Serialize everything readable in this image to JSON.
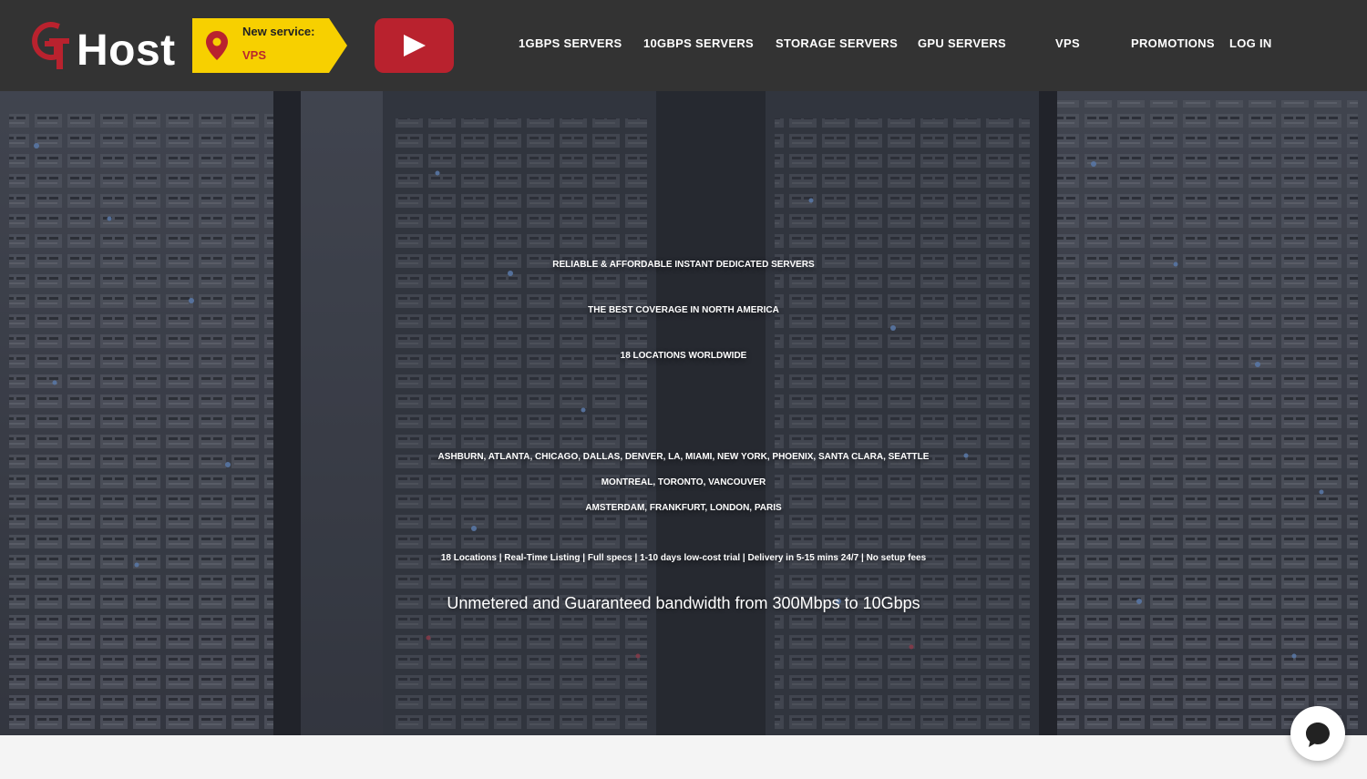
{
  "header": {
    "logo": {
      "text": "Host"
    },
    "promo": {
      "line1": "New service:",
      "line2": "VPS"
    },
    "nav": [
      {
        "label": "1GBPS SERVERS"
      },
      {
        "label": "10GBPS SERVERS"
      },
      {
        "label": "STORAGE SERVERS"
      },
      {
        "label": "GPU SERVERS"
      },
      {
        "label": "VPS"
      },
      {
        "label": "PROMOTIONS"
      },
      {
        "label": "LOG IN"
      }
    ]
  },
  "hero": {
    "headline": [
      "RELIABLE & AFFORDABLE INSTANT DEDICATED SERVERS",
      "THE BEST COVERAGE IN NORTH AMERICA",
      "18 LOCATIONS WORLDWIDE"
    ],
    "locations": [
      "ASHBURN, ATLANTA, CHICAGO, DALLAS, DENVER, LA, MIAMI, NEW YORK, PHOENIX, SANTA CLARA, SEATTLE",
      "MONTREAL, TORONTO, VANCOUVER",
      "AMSTERDAM, FRANKFURT, LONDON, PARIS"
    ],
    "features": "18 Locations | Real-Time Listing | Full specs | 1-10 days low-cost trial | Delivery in 5-15 mins 24/7 | No setup fees",
    "bandwidth": "Unmetered and Guaranteed bandwidth from 300Mbps to 10Gbps"
  },
  "colors": {
    "header_bg": "#333333",
    "brand_red": "#b9222e",
    "promo_yellow": "#f7d000"
  },
  "icons": {
    "location": "map-pin-icon",
    "video": "play-icon",
    "chat": "chat-bubble-icon"
  }
}
